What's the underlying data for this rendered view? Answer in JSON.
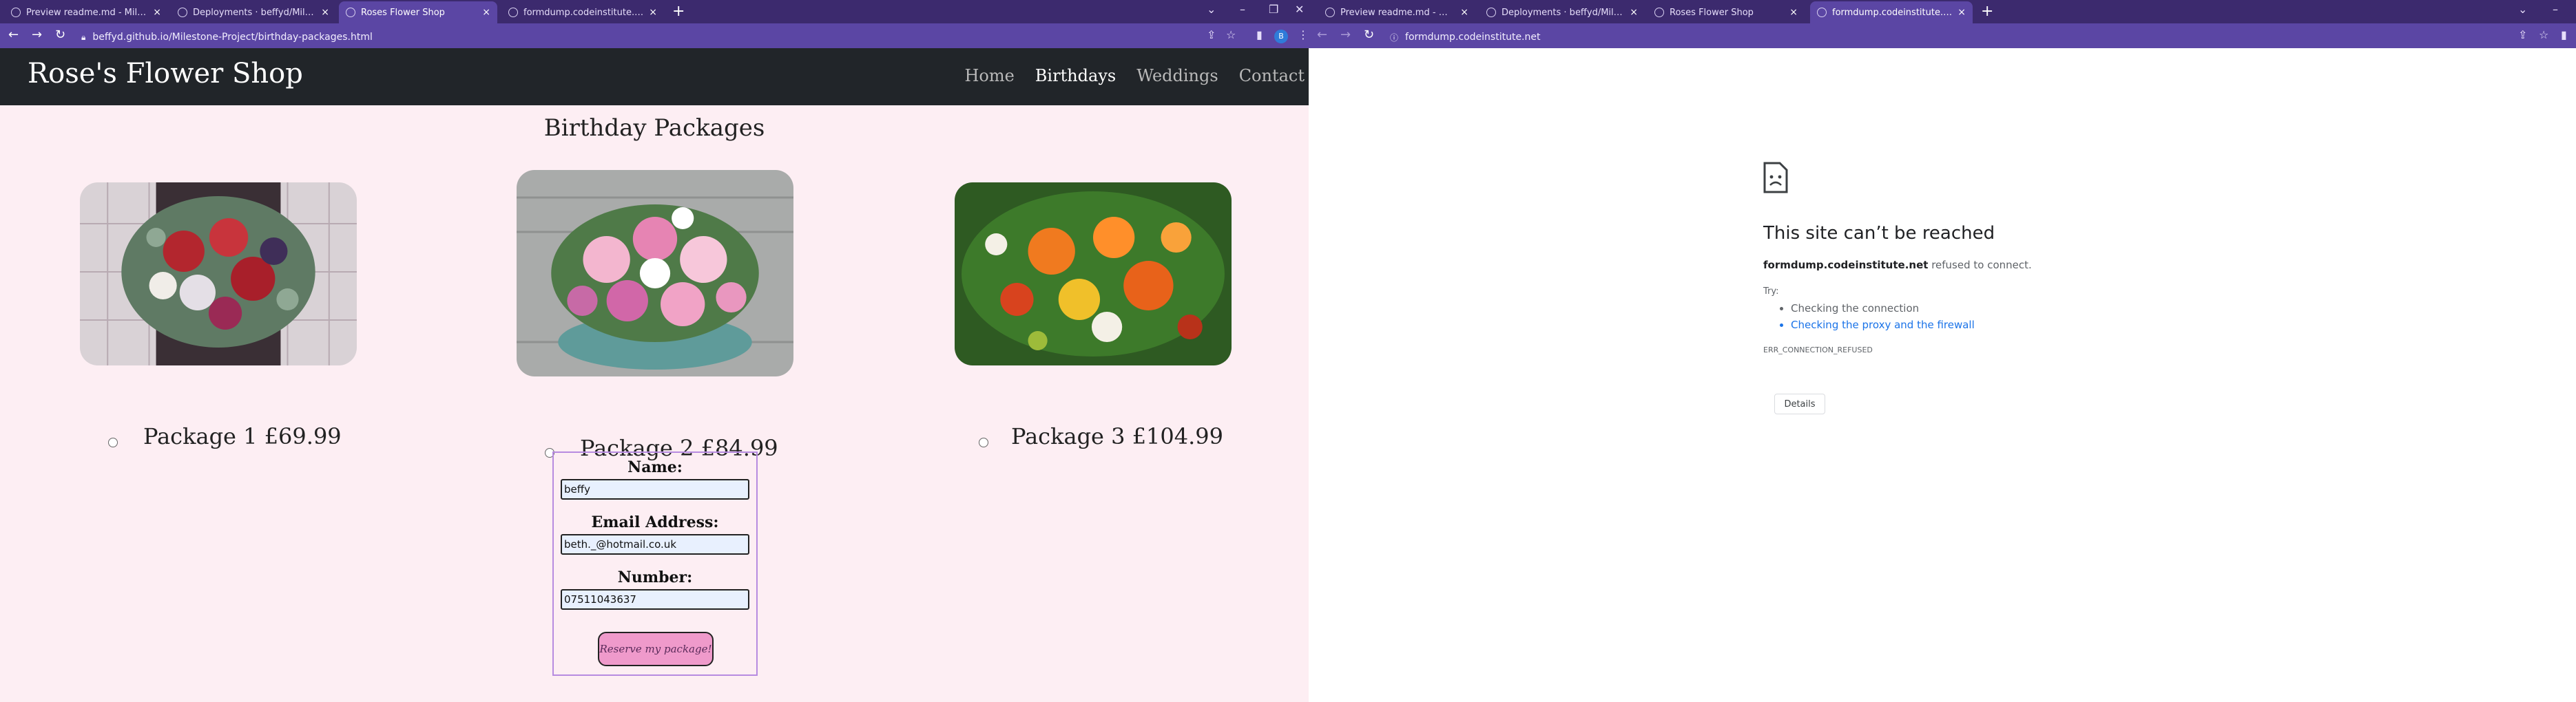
{
  "left_browser": {
    "tabs": [
      {
        "label": "Preview readme.md - Milestone"
      },
      {
        "label": "Deployments · beffyd/Milestone"
      },
      {
        "label": "Roses Flower Shop",
        "active": true
      },
      {
        "label": "formdump.codeinstitute.net"
      }
    ],
    "url": "beffyd.github.io/Milestone-Project/birthday-packages.html",
    "profile_initial": "B",
    "new_tab": "+",
    "close": "×"
  },
  "site": {
    "brand": "Rose's Flower Shop",
    "nav": [
      "Home",
      "Birthdays",
      "Weddings",
      "Contact"
    ],
    "active_nav": "Birthdays",
    "title": "Birthday Packages",
    "packages": [
      {
        "label": "Package 1 £69.99",
        "image": "bouquet-red-roses"
      },
      {
        "label": "Package 2 £84.99",
        "image": "bouquet-pink-roses"
      },
      {
        "label": "Package 3 £104.99",
        "image": "bouquet-orange-mixed"
      }
    ],
    "form": {
      "name_label": "Name:",
      "name_value": "beffy",
      "email_label": "Email Address:",
      "email_value": "beth._@hotmail.co.uk",
      "number_label": "Number:",
      "number_value": "07511043637",
      "submit_label": "Reserve my package!"
    }
  },
  "right_browser": {
    "tabs": [
      {
        "label": "Preview readme.md - Milestone"
      },
      {
        "label": "Deployments · beffyd/Milestone"
      },
      {
        "label": "Roses Flower Shop"
      },
      {
        "label": "formdump.codeinstitute.net",
        "active": true
      }
    ],
    "url": "formdump.codeinstitute.net",
    "new_tab": "+",
    "close": "×"
  },
  "error_page": {
    "title": "This site can’t be reached",
    "host": "formdump.codeinstitute.net",
    "desc_suffix": " refused to connect.",
    "try_label": "Try:",
    "suggestions": [
      "Checking the connection",
      "Checking the proxy and the firewall"
    ],
    "error_code": "ERR_CONNECTION_REFUSED",
    "details_label": "Details"
  },
  "colors": {
    "chrome_tabstrip": "#3c2a6e",
    "chrome_toolbar": "#5b46a4",
    "site_bg": "#fdeef3",
    "site_nav_bg": "#212529",
    "button_pink": "#ef9acb"
  }
}
